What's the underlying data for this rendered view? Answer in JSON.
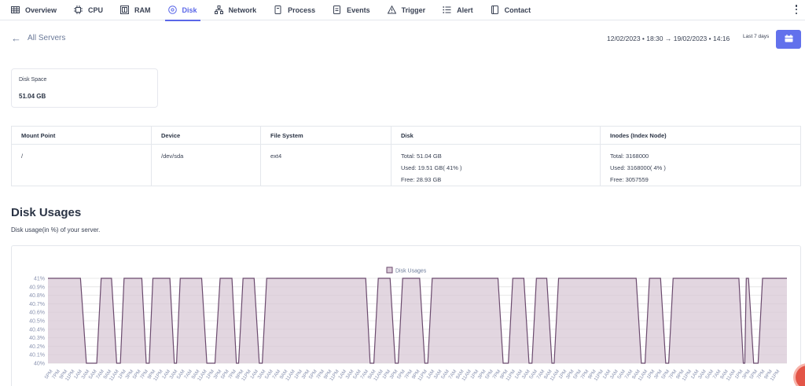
{
  "nav": {
    "tabs": [
      {
        "label": "Overview",
        "icon": "table-icon"
      },
      {
        "label": "CPU",
        "icon": "cpu-icon"
      },
      {
        "label": "RAM",
        "icon": "ram-icon"
      },
      {
        "label": "Disk",
        "icon": "disk-icon",
        "active": true
      },
      {
        "label": "Network",
        "icon": "network-icon"
      },
      {
        "label": "Process",
        "icon": "process-icon"
      },
      {
        "label": "Events",
        "icon": "events-icon"
      },
      {
        "label": "Trigger",
        "icon": "trigger-icon"
      },
      {
        "label": "Alert",
        "icon": "alert-list-icon"
      },
      {
        "label": "Contact",
        "icon": "contact-icon"
      }
    ]
  },
  "header": {
    "back_label": "All Servers",
    "date_range": "12/02/2023 • 18:30 → 19/02/2023 • 14:16",
    "preset": "Last 7 days"
  },
  "disk_space": {
    "label": "Disk Space",
    "value": "51.04 GB"
  },
  "mount_table": {
    "headers": [
      "Mount Point",
      "Device",
      "File System",
      "Disk",
      "Inodes (Index Node)"
    ],
    "row": {
      "mount_point": "/",
      "device": "/dev/sda",
      "file_system": "ext4",
      "disk_total": "Total: 51.04 GB",
      "disk_used": "Used: 19.51 GB( 41% )",
      "disk_free": "Free: 28.93 GB",
      "inodes_total": "Total: 3168000",
      "inodes_used": "Used: 3168000( 4% )",
      "inodes_free": "Free: 3057559"
    }
  },
  "section": {
    "title": "Disk Usages",
    "subtitle": "Disk usage(in %) of your server."
  },
  "colors": {
    "accent": "#5a67e8",
    "series_line": "#6b4a6e",
    "series_fill": "#d8c8d6"
  },
  "chart_data": {
    "type": "area",
    "series": [
      {
        "name": "Disk Usages"
      }
    ],
    "y_ticks": [
      "41%",
      "40.9%",
      "40.8%",
      "40.7%",
      "40.6%",
      "40.5%",
      "40.4%",
      "40.3%",
      "40.2%",
      "40.1%",
      "40%"
    ],
    "ylim": [
      40,
      41
    ],
    "x_tick_labels": [
      "5PM",
      "7PM",
      "9PM",
      "11PM",
      "1AM",
      "3AM",
      "5AM",
      "7AM",
      "9AM",
      "11AM",
      "1PM",
      "3PM",
      "5PM",
      "7PM",
      "9PM",
      "11PM",
      "1AM",
      "3AM",
      "5AM",
      "7AM",
      "9AM",
      "11AM",
      "1PM",
      "3PM",
      "5PM",
      "7PM",
      "9PM",
      "11PM",
      "1AM",
      "3AM",
      "5AM",
      "7AM",
      "9AM",
      "11AM",
      "1PM",
      "3PM",
      "5PM",
      "7PM",
      "9PM",
      "11PM",
      "1AM",
      "3AM",
      "5AM",
      "7AM",
      "9AM",
      "11AM",
      "1PM",
      "3PM",
      "5PM",
      "7PM",
      "9PM",
      "11PM",
      "1AM",
      "3AM",
      "5AM",
      "7AM",
      "9AM",
      "11AM",
      "1PM",
      "3PM",
      "5PM",
      "7PM",
      "9PM",
      "11PM",
      "1AM",
      "3AM",
      "5AM",
      "7AM",
      "9AM",
      "11AM",
      "1PM",
      "3PM",
      "5PM",
      "7PM",
      "9PM",
      "11PM",
      "1AM",
      "3AM",
      "5AM",
      "7AM",
      "9AM",
      "11AM",
      "1PM",
      "3PM",
      "5PM",
      "7PM",
      "9PM",
      "11PM",
      "1AM",
      "3AM",
      "5AM",
      "7AM",
      "9AM",
      "11AM",
      "1PM",
      "3PM",
      "5PM",
      "7PM",
      "9PM",
      "11PM"
    ],
    "x_range": [
      0,
      100
    ],
    "points": [
      [
        0,
        41
      ],
      [
        4.4,
        41
      ],
      [
        5.2,
        40
      ],
      [
        6.6,
        40
      ],
      [
        7.2,
        41
      ],
      [
        8.6,
        41
      ],
      [
        9.3,
        40
      ],
      [
        9.8,
        40
      ],
      [
        10.3,
        41
      ],
      [
        12.7,
        41
      ],
      [
        13.3,
        40
      ],
      [
        13.7,
        40
      ],
      [
        14.2,
        41
      ],
      [
        16.5,
        41
      ],
      [
        17.1,
        40
      ],
      [
        17.4,
        40
      ],
      [
        17.9,
        41
      ],
      [
        20.8,
        41
      ],
      [
        21.5,
        40
      ],
      [
        22.6,
        40
      ],
      [
        23.3,
        41
      ],
      [
        24.9,
        41
      ],
      [
        25.5,
        40
      ],
      [
        25.8,
        40
      ],
      [
        26.4,
        41
      ],
      [
        27.9,
        41
      ],
      [
        28.6,
        40
      ],
      [
        29.0,
        40
      ],
      [
        29.6,
        41
      ],
      [
        43.0,
        41
      ],
      [
        43.6,
        40
      ],
      [
        44.1,
        40
      ],
      [
        44.7,
        41
      ],
      [
        46.3,
        41
      ],
      [
        47.0,
        40
      ],
      [
        47.4,
        40
      ],
      [
        48.0,
        41
      ],
      [
        50.3,
        41
      ],
      [
        51.0,
        40
      ],
      [
        51.4,
        40
      ],
      [
        52.0,
        41
      ],
      [
        60.9,
        41
      ],
      [
        61.6,
        40
      ],
      [
        62.3,
        40
      ],
      [
        62.9,
        41
      ],
      [
        64.4,
        41
      ],
      [
        65.1,
        40
      ],
      [
        65.5,
        40
      ],
      [
        66.1,
        41
      ],
      [
        67.5,
        41
      ],
      [
        68.2,
        40
      ],
      [
        68.5,
        40
      ],
      [
        69.1,
        41
      ],
      [
        79.6,
        41
      ],
      [
        80.3,
        40
      ],
      [
        80.8,
        40
      ],
      [
        81.4,
        41
      ],
      [
        82.9,
        41
      ],
      [
        83.6,
        40
      ],
      [
        84.0,
        40
      ],
      [
        84.6,
        41
      ],
      [
        93.5,
        41
      ],
      [
        94.1,
        40
      ],
      [
        94.3,
        40
      ],
      [
        94.5,
        41
      ],
      [
        94.8,
        41
      ],
      [
        95.5,
        40
      ],
      [
        96.1,
        40
      ],
      [
        96.7,
        41
      ],
      [
        100,
        41
      ]
    ],
    "legend": "top-center",
    "grid": true
  }
}
